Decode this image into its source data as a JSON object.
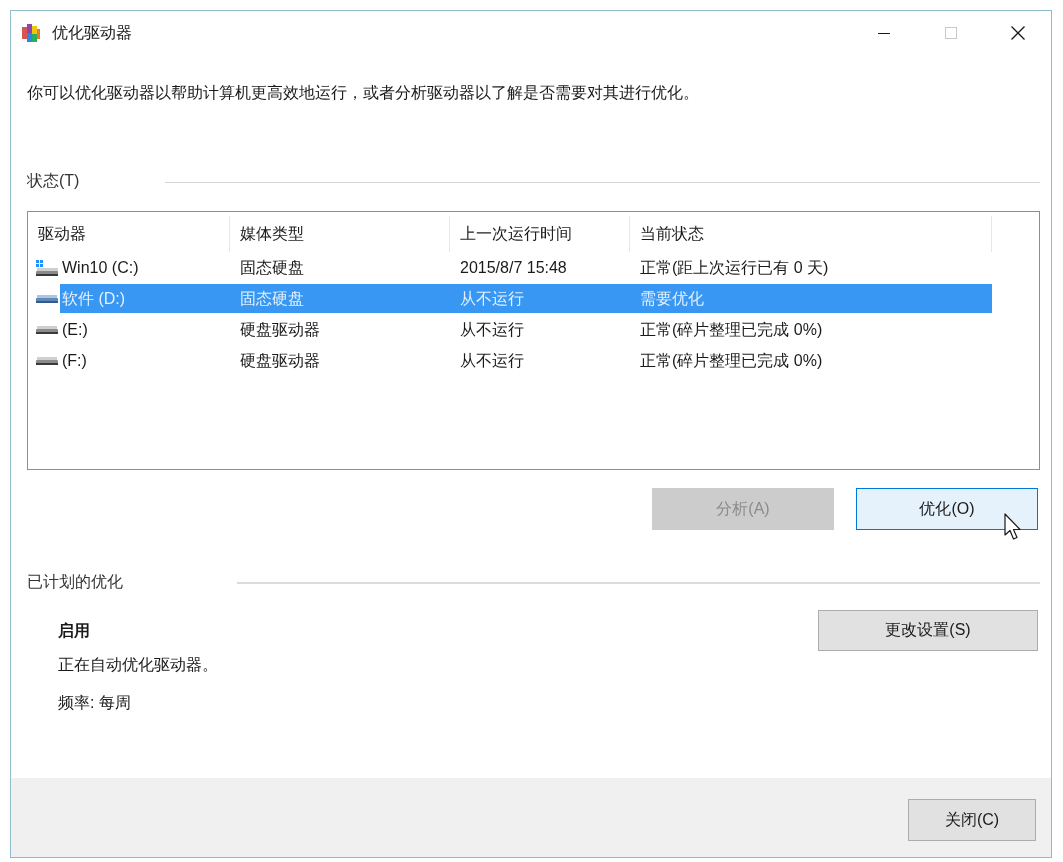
{
  "window": {
    "title": "优化驱动器",
    "controls": [
      {
        "kind": "minimize",
        "disabled": false
      },
      {
        "kind": "maximize",
        "disabled": true
      },
      {
        "kind": "close",
        "disabled": false
      }
    ]
  },
  "description": "你可以优化驱动器以帮助计算机更高效地运行，或者分析驱动器以了解是否需要对其进行优化。",
  "status": {
    "label": "状态(T)",
    "table": {
      "columns": [
        "驱动器",
        "媒体类型",
        "上一次运行时间",
        "当前状态"
      ],
      "rows": [
        {
          "kind": "system",
          "drive": "Win10 (C:)",
          "media_type": "固态硬盘",
          "last_run": "2015/8/7 15:48",
          "current_status": "正常(距上次运行已有 0 天)",
          "selected": false
        },
        {
          "kind": "drive",
          "drive": "软件 (D:)",
          "media_type": "固态硬盘",
          "last_run": "从不运行",
          "current_status": "需要优化",
          "selected": true
        },
        {
          "kind": "drive",
          "drive": "(E:)",
          "media_type": "硬盘驱动器",
          "last_run": "从不运行",
          "current_status": "正常(碎片整理已完成 0%)",
          "selected": false
        },
        {
          "kind": "drive",
          "drive": "(F:)",
          "media_type": "硬盘驱动器",
          "last_run": "从不运行",
          "current_status": "正常(碎片整理已完成 0%)",
          "selected": false
        }
      ]
    }
  },
  "actions": [
    {
      "label": "分析(A)",
      "disabled": true,
      "hovered": false
    },
    {
      "label": "优化(O)",
      "disabled": false,
      "hovered": true
    }
  ],
  "schedule": {
    "label": "已计划的优化",
    "state": "启用",
    "description": "正在自动优化驱动器。",
    "frequency": "频率: 每周",
    "button": {
      "label": "更改设置(S)"
    }
  },
  "footer": {
    "buttons": [
      {
        "label": "关闭(C)"
      }
    ]
  }
}
